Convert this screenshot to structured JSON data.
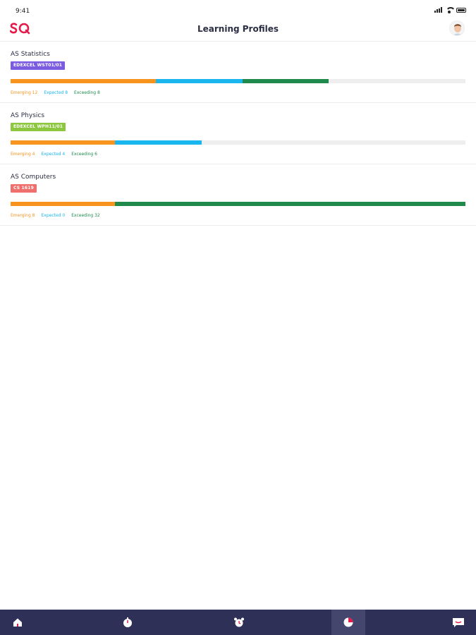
{
  "status_bar": {
    "time": "9:41"
  },
  "header": {
    "title": "Learning Profiles"
  },
  "profiles": [
    {
      "name": "AS Statistics",
      "badge": "EDEXCEL WST01/01",
      "badge_color": "#7b5ce0",
      "legend": {
        "emerging": "Emerging 12",
        "expected": "Expected 8",
        "exceeding": "Exceeding 8"
      },
      "levels": [
        {
          "color": "#f7941d",
          "fraction": 0.32
        },
        {
          "color": "#1ab6f0",
          "fraction": 0.19
        },
        {
          "color": "#1f8a4c",
          "fraction": 0.19
        }
      ]
    },
    {
      "name": "AS Physics",
      "badge": "EDEXCEL WPH11/01",
      "badge_color": "#8dc63f",
      "legend": {
        "emerging": "Emerging 4",
        "expected": "Expected 4",
        "exceeding": "Exceeding 6"
      },
      "levels": [
        {
          "color": "#f7941d",
          "fraction": 0.23
        },
        {
          "color": "#1ab6f0",
          "fraction": 0.19
        }
      ]
    },
    {
      "name": "AS Computers",
      "badge": "CS 1619",
      "badge_color": "#ef6f6c",
      "legend": {
        "emerging": "Emerging 8",
        "expected": "Expected 0",
        "exceeding": "Exceeding 32"
      },
      "levels": [
        {
          "color": "#f7941d",
          "fraction": 0.23
        },
        {
          "color": "#1f8a4c",
          "fraction": 0.77
        }
      ]
    }
  ],
  "legend_colors": {
    "emerging": "#f7941d",
    "expected": "#1ab6f0",
    "exceeding": "#1f8a4c"
  },
  "brand": {
    "accent": "#e6194b",
    "tab_bar": "#2e3058"
  },
  "tabs": [
    {
      "icon": "home-icon",
      "active": false
    },
    {
      "icon": "stopwatch-icon",
      "active": false
    },
    {
      "icon": "alarm-clock-icon",
      "active": false
    },
    {
      "icon": "pie-chart-icon",
      "active": true
    },
    {
      "icon": "chat-icon",
      "active": false
    }
  ]
}
